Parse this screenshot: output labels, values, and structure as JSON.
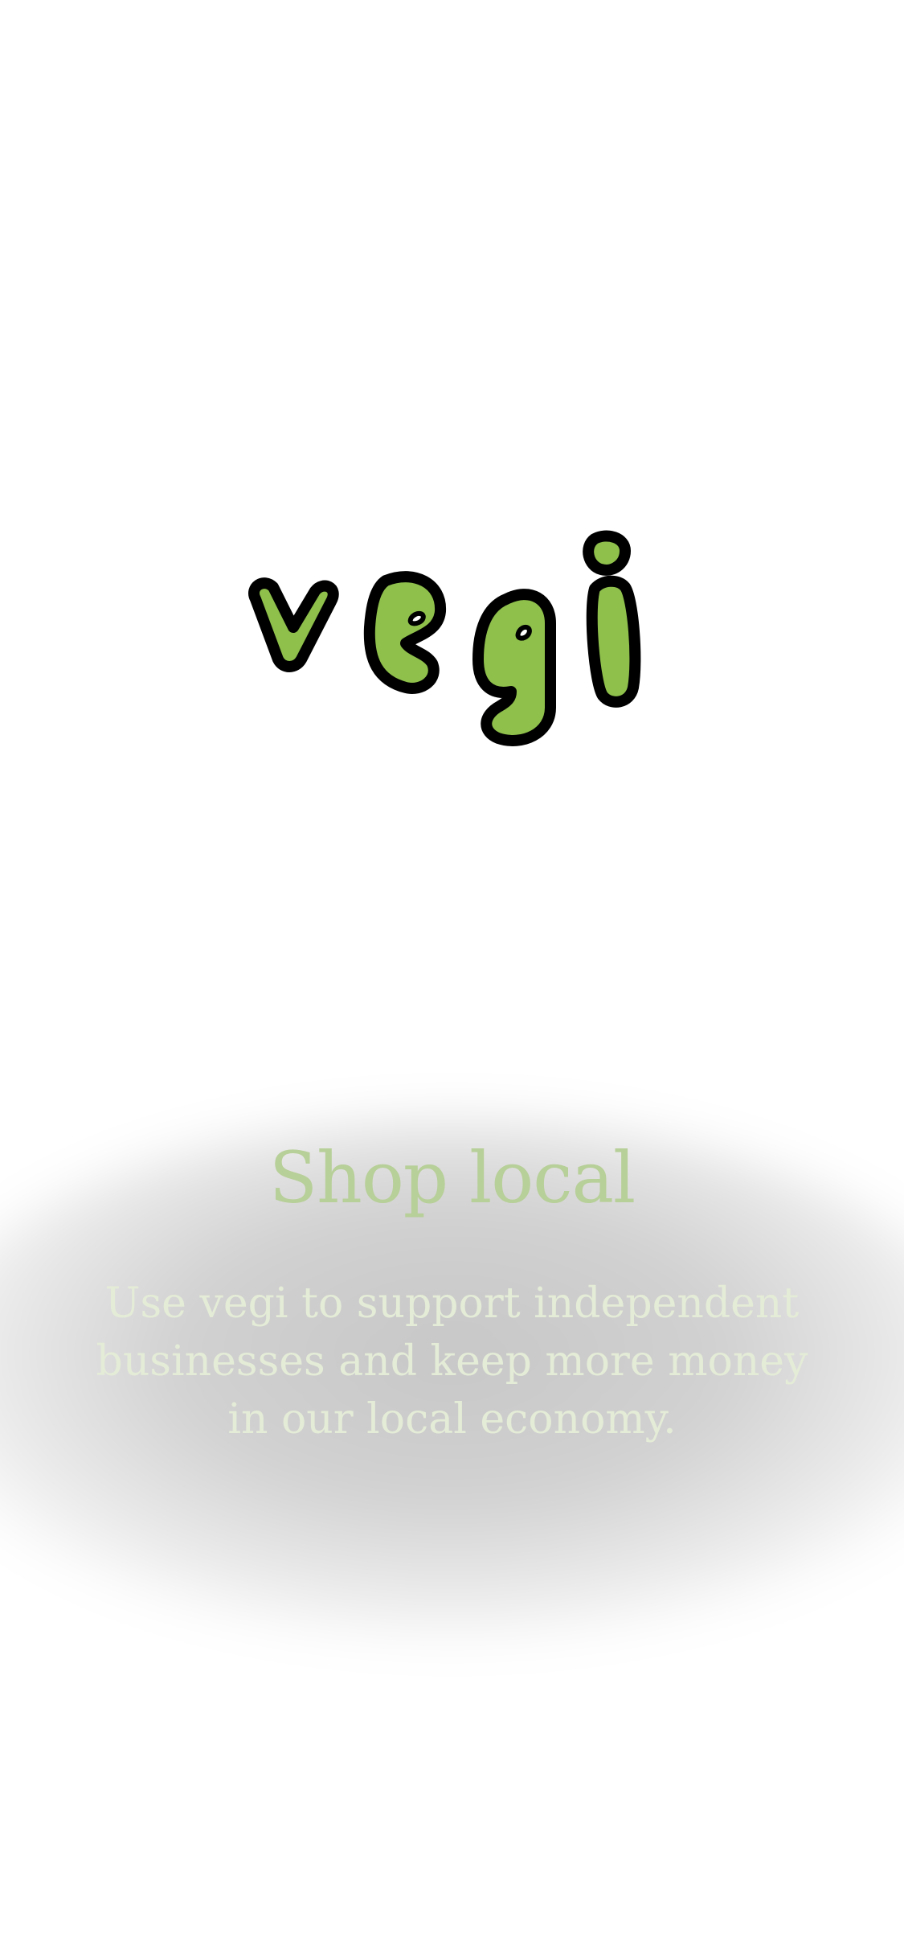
{
  "brand": {
    "logo_text": "vegi",
    "logo_fill_color": "#8ec04b",
    "logo_outline_color": "#000000"
  },
  "onboarding": {
    "title": "Shop local",
    "description": "Use vegi to support independent businesses and keep more money in our local economy."
  },
  "colors": {
    "background": "#ffffff",
    "title": "#b7cf98",
    "description": "#e4ecd7"
  }
}
